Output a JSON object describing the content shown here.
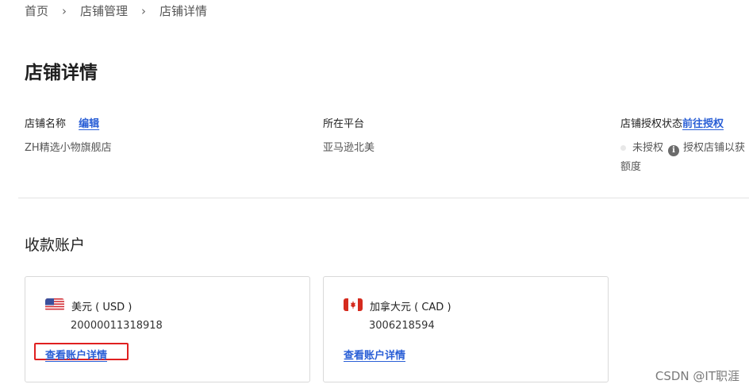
{
  "breadcrumb": {
    "items": [
      "首页",
      "店铺管理",
      "店铺详情"
    ]
  },
  "page": {
    "title": "店铺详情"
  },
  "info": {
    "store_name_label": "店铺名称",
    "edit_link": "编辑",
    "store_name_value": "ZH精选小物旗舰店",
    "platform_label": "所在平台",
    "platform_value": "亚马逊北美",
    "auth_label": "店铺授权状态",
    "auth_link": "前往授权",
    "auth_status": "未授权",
    "auth_hint": "授权店铺以获",
    "auth_hint_line2": "额度"
  },
  "accounts": {
    "section_title": "收款账户",
    "cards": [
      {
        "currency": "美元 ( USD )",
        "account_number": "20000011318918",
        "detail_link": "查看账户详情",
        "flag": "us-flag-icon"
      },
      {
        "currency": "加拿大元 ( CAD )",
        "account_number": "3006218594",
        "detail_link": "查看账户详情",
        "flag": "ca-flag-icon"
      }
    ]
  },
  "watermark": "CSDN @IT职涯",
  "colors": {
    "link": "#2a5fd6",
    "highlight": "#e02020",
    "divider": "#e3e3e3"
  }
}
